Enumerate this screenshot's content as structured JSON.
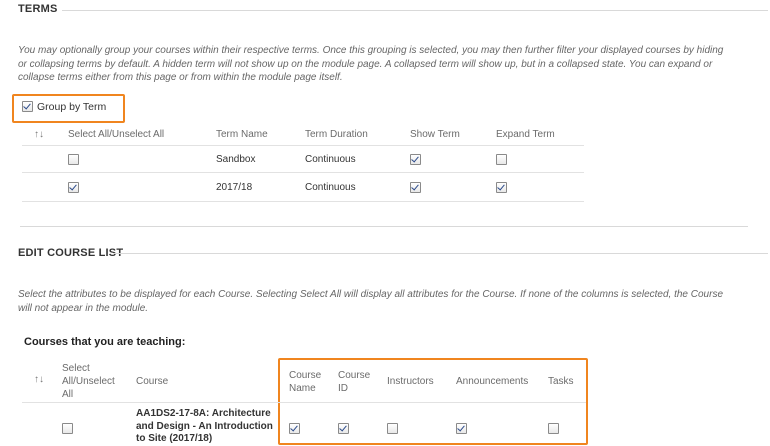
{
  "terms": {
    "title": "TERMS",
    "description": "You may optionally group your courses within their respective terms. Once this grouping is selected, you may then further filter your displayed courses by hiding or collapsing terms by default. A hidden term will not show up on the module page. A collapsed term will show up, but in a collapsed state. You can expand or collapse terms either from this page or from within the module page itself.",
    "group_by_term_label": "Group by Term",
    "group_by_term_checked": true,
    "sort_icon": "↑↓",
    "headers": {
      "select_all": "Select All/Unselect All",
      "term_name": "Term Name",
      "term_duration": "Term Duration",
      "show_term": "Show Term",
      "expand_term": "Expand Term"
    },
    "rows": [
      {
        "selected": false,
        "name": "Sandbox",
        "duration": "Continuous",
        "show": true,
        "expand": false
      },
      {
        "selected": true,
        "name": "2017/18",
        "duration": "Continuous",
        "show": true,
        "expand": true
      }
    ]
  },
  "edit_course_list": {
    "title": "EDIT COURSE LIST",
    "description": "Select the attributes to be displayed for each Course. Selecting Select All will display all attributes for the Course. If none of the columns is selected, the Course will not appear in the module.",
    "teaching_heading": "Courses that you are teaching:",
    "sort_icon": "↑↓",
    "headers": {
      "select_all": "Select All/Unselect All",
      "course": "Course",
      "course_name": "Course Name",
      "course_id": "Course ID",
      "instructors": "Instructors",
      "announcements": "Announcements",
      "tasks": "Tasks"
    },
    "rows": [
      {
        "selected": false,
        "course": "AA1DS2-17-8A: Architecture and Design - An Introduction to Site (2017/18)",
        "course_name": true,
        "course_id": true,
        "instructors": false,
        "announcements": true,
        "tasks": false
      }
    ]
  },
  "colors": {
    "highlight": "#f0851f",
    "rule": "#d9d9d9"
  }
}
